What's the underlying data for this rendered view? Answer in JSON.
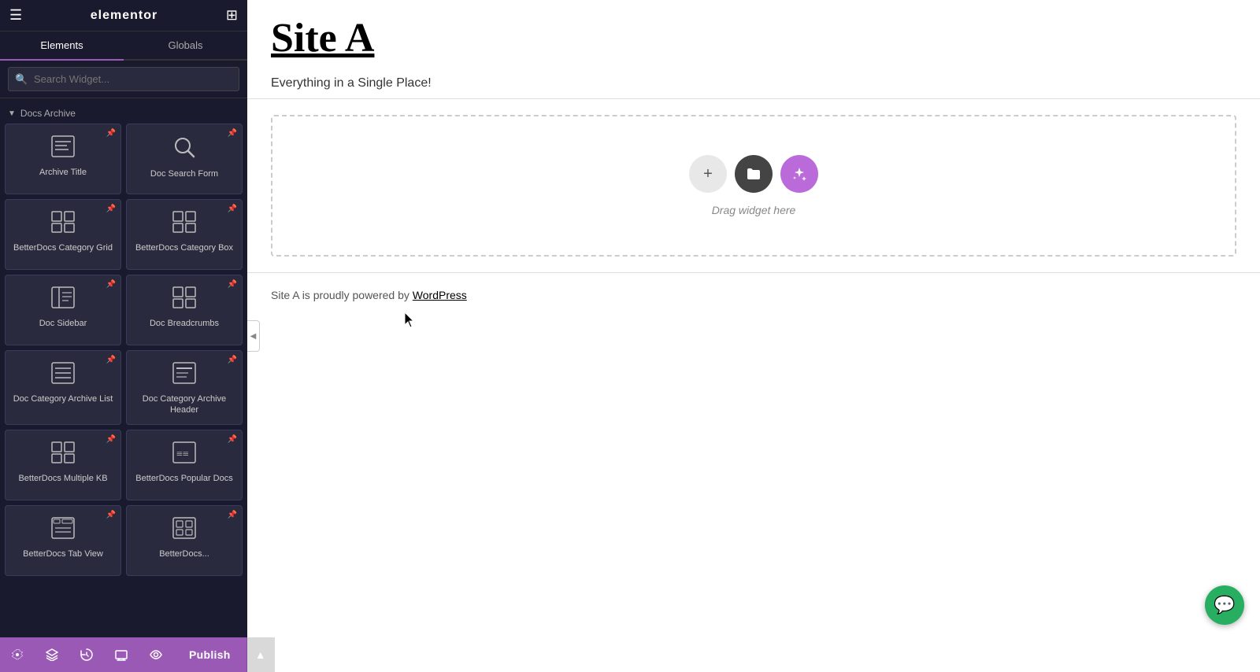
{
  "sidebar": {
    "logo": "elementor",
    "tabs": [
      {
        "label": "Elements",
        "active": true
      },
      {
        "label": "Globals",
        "active": false
      }
    ],
    "search_placeholder": "Search Widget...",
    "section_label": "Docs Archive",
    "widgets": [
      {
        "id": "archive-title",
        "label": "Archive Title",
        "icon": "grid"
      },
      {
        "id": "doc-search-form",
        "label": "Doc Search Form",
        "icon": "search"
      },
      {
        "id": "betterdocs-category-grid",
        "label": "BetterDocs Category Grid",
        "icon": "grid"
      },
      {
        "id": "betterdocs-category-box",
        "label": "BetterDocs Category Box",
        "icon": "grid2"
      },
      {
        "id": "doc-sidebar",
        "label": "Doc Sidebar",
        "icon": "sidebar"
      },
      {
        "id": "doc-breadcrumbs",
        "label": "Doc Breadcrumbs",
        "icon": "grid2"
      },
      {
        "id": "doc-category-archive-list",
        "label": "Doc Category Archive List",
        "icon": "list"
      },
      {
        "id": "doc-category-archive-header",
        "label": "Doc Category Archive Header",
        "icon": "grid2"
      },
      {
        "id": "betterdocs-multiple-kb",
        "label": "BetterDocs Multiple KB",
        "icon": "grid"
      },
      {
        "id": "betterdocs-popular-docs",
        "label": "BetterDocs Popular Docs",
        "icon": "grid2"
      },
      {
        "id": "betterdocs-tab-view",
        "label": "BetterDocs Tab View",
        "icon": "grid2"
      },
      {
        "id": "betterdocs-extra",
        "label": "BetterDocs...",
        "icon": "grid"
      }
    ]
  },
  "bottom_bar": {
    "icons": [
      "settings",
      "layers",
      "history",
      "responsive",
      "preview"
    ],
    "publish_label": "Publish",
    "chevron": "▲"
  },
  "canvas": {
    "site_title": "Site A",
    "site_tagline": "Everything in a Single Place!",
    "drag_label": "Drag widget here",
    "footer_text": "Site A is proudly powered by ",
    "footer_link": "WordPress"
  },
  "chat": {
    "icon": "💬"
  }
}
